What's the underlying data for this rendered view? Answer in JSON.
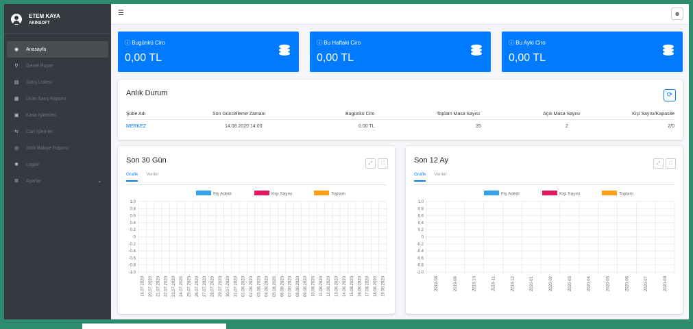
{
  "user": {
    "name": "ETEM KAYA",
    "company": "AKINSOFT"
  },
  "sidebar": {
    "items": [
      {
        "label": "Anasayfa",
        "icon": "dashboard-icon",
        "glyph": "◉",
        "active": true
      },
      {
        "label": "Genel Rapor",
        "icon": "sitemap-icon",
        "glyph": "⚲"
      },
      {
        "label": "Satış Listesi",
        "icon": "receipt-icon",
        "glyph": "▤"
      },
      {
        "label": "Ürün Satış Raporu",
        "icon": "products-icon",
        "glyph": "▦"
      },
      {
        "label": "Kasa İşlemleri",
        "icon": "cash-register-icon",
        "glyph": "▣"
      },
      {
        "label": "Cari İşlemler",
        "icon": "accounts-icon",
        "glyph": "⇆"
      },
      {
        "label": "Stok Bakiye Raporu",
        "icon": "database-icon",
        "glyph": "◎"
      },
      {
        "label": "Loglar",
        "icon": "bug-icon",
        "glyph": "✱"
      },
      {
        "label": "Ayarlar",
        "icon": "gear-icon",
        "glyph": "⚙",
        "chevron": "⌄"
      }
    ]
  },
  "navbar": {
    "menu_icon": "☰",
    "user_icon": "👤"
  },
  "stats": [
    {
      "title": "Bugünkü Ciro",
      "value": "0,00 TL"
    },
    {
      "title": "Bu Haftaki Ciro",
      "value": "0,00 TL"
    },
    {
      "title": "Bu Ayki Ciro",
      "value": "0,00 TL"
    }
  ],
  "status": {
    "title": "Anlık Durum",
    "refresh_icon": "⟳",
    "headers": [
      "Şube Adı",
      "Son Güncelleme Zamanı",
      "Bugünkü Ciro",
      "Toplam Masa Sayısı",
      "Açık Masa Sayısı",
      "Kişi Sayısı/Kapasite"
    ],
    "row": [
      "MERKEZ",
      "14.08.2020 14:03",
      "0.00 TL",
      "35",
      "2",
      "2/0"
    ]
  },
  "panels": [
    {
      "title": "Son 30 Gün",
      "tabs": [
        "Grafik",
        "Veriler"
      ],
      "expand": "⤢",
      "fullscreen": "⛶"
    },
    {
      "title": "Son 12 Ay",
      "tabs": [
        "Grafik",
        "Veriler"
      ],
      "expand": "⤢",
      "fullscreen": "⛶"
    }
  ],
  "colors": {
    "blue": "#007bff",
    "fis": "#36a2eb",
    "kisi": "#e6195b",
    "toplam": "#ff9f1a"
  },
  "chart_data": [
    {
      "type": "bar",
      "legend": [
        "Fiş Adedi",
        "Kişi Sayısı",
        "Toplam"
      ],
      "yticks": [
        "1.0",
        "0.8",
        "0.6",
        "0.4",
        "0.2",
        "0",
        "-0.2",
        "-0.4",
        "-0.6",
        "-0.8",
        "-1.0"
      ],
      "ylim": [
        -1,
        1
      ],
      "categories": [
        "19.07.2020",
        "20.07.2020",
        "21.07.2020",
        "22.07.2020",
        "23.07.2020",
        "24.07.2020",
        "25.07.2020",
        "26.07.2020",
        "27.07.2020",
        "28.07.2020",
        "29.07.2020",
        "30.07.2020",
        "31.07.2020",
        "01.08.2020",
        "02.08.2020",
        "03.08.2020",
        "04.08.2020",
        "05.08.2020",
        "06.08.2020",
        "07.08.2020",
        "08.08.2020",
        "09.08.2020",
        "10.08.2020",
        "11.08.2020",
        "12.08.2020",
        "13.08.2020",
        "14.08.2020",
        "15.08.2020",
        "16.08.2020",
        "17.08.2020",
        "18.08.2020",
        "19.08.2020"
      ],
      "series": [
        {
          "name": "Fiş Adedi",
          "values": []
        },
        {
          "name": "Kişi Sayısı",
          "values": []
        },
        {
          "name": "Toplam",
          "values": []
        }
      ]
    },
    {
      "type": "bar",
      "legend": [
        "Fiş Adedi",
        "Kişi Sayısı",
        "Toplam"
      ],
      "yticks": [
        "1.0",
        "0.8",
        "0.6",
        "0.4",
        "0.2",
        "0",
        "-0.2",
        "-0.4",
        "-0.6",
        "-0.8",
        "-1.0"
      ],
      "ylim": [
        -1,
        1
      ],
      "categories": [
        "2019-08",
        "2019-09",
        "2019-10",
        "2019-11",
        "2019-12",
        "2020-01",
        "2020-02",
        "2020-03",
        "2020-04",
        "2020-05",
        "2020-06",
        "2020-07",
        "2020-08"
      ],
      "series": [
        {
          "name": "Fiş Adedi",
          "values": []
        },
        {
          "name": "Kişi Sayısı",
          "values": []
        },
        {
          "name": "Toplam",
          "values": []
        }
      ]
    }
  ]
}
